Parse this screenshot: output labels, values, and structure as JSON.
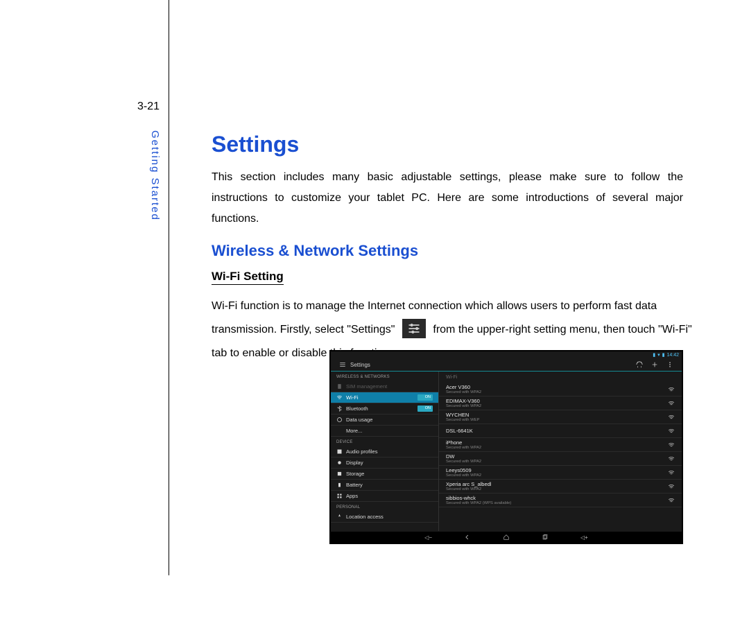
{
  "page": {
    "number": "3-21",
    "sidebar_label": "Getting Started"
  },
  "headings": {
    "h1": "Settings",
    "h2": "Wireless & Network Settings",
    "h3": "Wi-Fi Setting"
  },
  "paragraphs": {
    "intro": "This section includes many basic adjustable settings, please make sure to follow the instructions to customize your tablet PC. Here are some introductions of several major functions.",
    "wifi_line1": "Wi-Fi  function  is  to  manage  the  Internet  connection  which  allows  users  to  perform  fast  data",
    "wifi_line2_a": "transmission. Firstly, select \"Settings\"",
    "wifi_line2_b": "from the upper-right setting menu, then touch \"Wi-Fi\"",
    "wifi_line3": "tab to enable or disable this function."
  },
  "screenshot": {
    "status_time": "14:42",
    "title": "Settings",
    "sections": {
      "wireless": "WIRELESS & NETWORKS",
      "device": "DEVICE",
      "personal": "PERSONAL"
    },
    "settings_items": {
      "sim": "SIM management",
      "wifi": "Wi-Fi",
      "bluetooth": "Bluetooth",
      "data_usage": "Data usage",
      "more": "More...",
      "audio": "Audio profiles",
      "display": "Display",
      "storage": "Storage",
      "battery": "Battery",
      "apps": "Apps",
      "location": "Location access"
    },
    "toggle_on": "ON",
    "right_header": "Wi-Fi",
    "networks": [
      {
        "name": "Acer V360",
        "sec": "Secured with WPA2"
      },
      {
        "name": "EDIMAX-V360",
        "sec": "Secured with WPA2"
      },
      {
        "name": "WYCHEN",
        "sec": "Secured with WEP"
      },
      {
        "name": "DSL-6641K",
        "sec": ""
      },
      {
        "name": "iPhone",
        "sec": "Secured with WPA2"
      },
      {
        "name": "DW",
        "sec": "Secured with WPA2"
      },
      {
        "name": "Leeys0509",
        "sec": "Secured with WPA2"
      },
      {
        "name": "Xperia arc S_albedl",
        "sec": "Secured with WPA2"
      },
      {
        "name": "sibbios-whck",
        "sec": "Secured with WPA2 (WPS available)"
      }
    ],
    "nav": {
      "vol_down": "−",
      "vol_up": "+"
    }
  }
}
